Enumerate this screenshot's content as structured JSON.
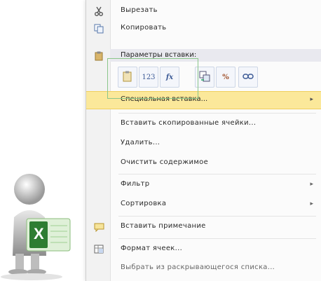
{
  "menu": {
    "cut_label": "Вырезать",
    "copy_label": "Копировать",
    "paste_options_header": "Параметры вставки:",
    "paste_options": [
      {
        "icon": "paste-icon"
      },
      {
        "icon": "paste-values-icon",
        "text": "123"
      },
      {
        "icon": "paste-formulas-icon",
        "text": "fx"
      },
      {
        "icon": "paste-transpose-icon"
      },
      {
        "icon": "paste-formatting-icon",
        "text": "%"
      },
      {
        "icon": "paste-link-icon"
      }
    ],
    "paste_special_label": "Специальная вставка...",
    "insert_copied_label": "Вставить скопированные ячейки...",
    "delete_label": "Удалить...",
    "clear_contents_label": "Очистить содержимое",
    "filter_label": "Фильтр",
    "sort_label": "Сортировка",
    "insert_comment_label": "Вставить примечание",
    "format_cells_label": "Формат ячеек...",
    "pick_list_label": "Выбрать из раскрывающегося списка..."
  },
  "colors": {
    "highlight": "#fbe89a",
    "focus_outline": "#8bc68a",
    "excel_green": "#2e7d32"
  },
  "figure": {
    "badge_text": "X"
  }
}
